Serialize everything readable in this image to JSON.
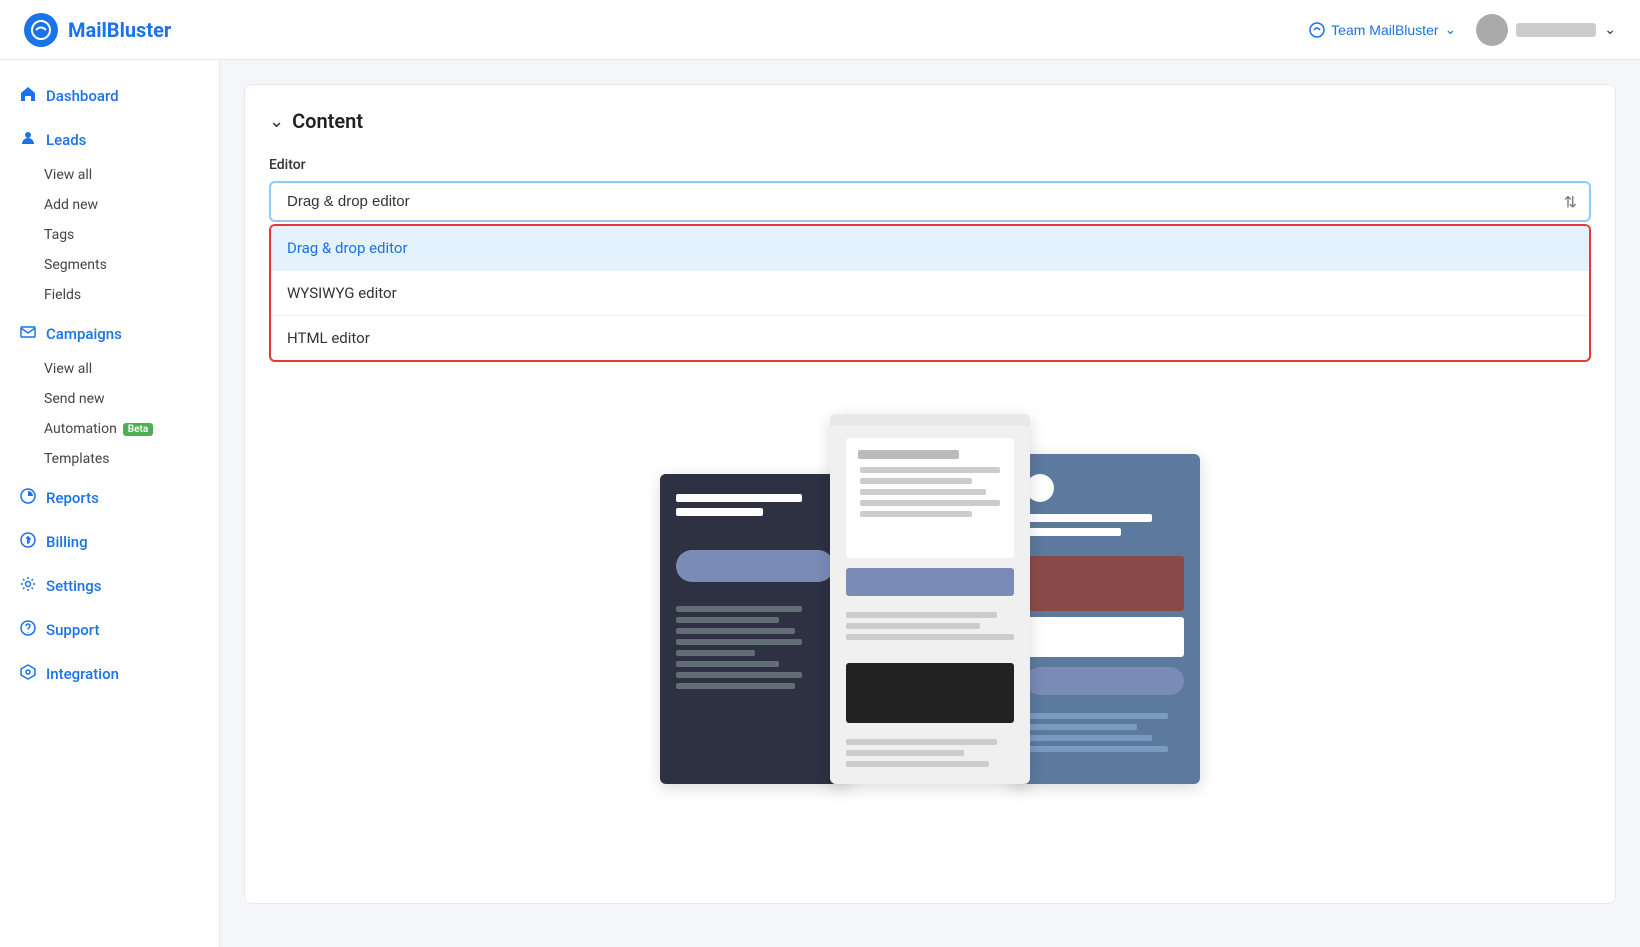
{
  "app": {
    "name": "MailBluster"
  },
  "topnav": {
    "logo_text": "MailBluster",
    "team_name": "Team MailBluster",
    "user_name": "••••••••"
  },
  "sidebar": {
    "items": [
      {
        "id": "dashboard",
        "label": "Dashboard",
        "icon": "home"
      },
      {
        "id": "leads",
        "label": "Leads",
        "icon": "person",
        "subitems": [
          "View all",
          "Add new",
          "Tags",
          "Segments",
          "Fields"
        ]
      },
      {
        "id": "campaigns",
        "label": "Campaigns",
        "icon": "email",
        "subitems": [
          "View all",
          "Send new",
          "Automation",
          "Templates"
        ]
      },
      {
        "id": "reports",
        "label": "Reports",
        "icon": "chart"
      },
      {
        "id": "billing",
        "label": "Billing",
        "icon": "billing"
      },
      {
        "id": "settings",
        "label": "Settings",
        "icon": "settings"
      },
      {
        "id": "support",
        "label": "Support",
        "icon": "support"
      },
      {
        "id": "integration",
        "label": "Integration",
        "icon": "integration"
      }
    ],
    "automation_beta_label": "Beta"
  },
  "content": {
    "section_title": "Content",
    "editor_label": "Editor",
    "editor_selected": "Drag & drop editor",
    "editor_options": [
      {
        "id": "drag-drop",
        "label": "Drag & drop editor",
        "active": true
      },
      {
        "id": "wysiwyg",
        "label": "WYSIWYG editor",
        "active": false
      },
      {
        "id": "html",
        "label": "HTML editor",
        "active": false
      }
    ]
  }
}
